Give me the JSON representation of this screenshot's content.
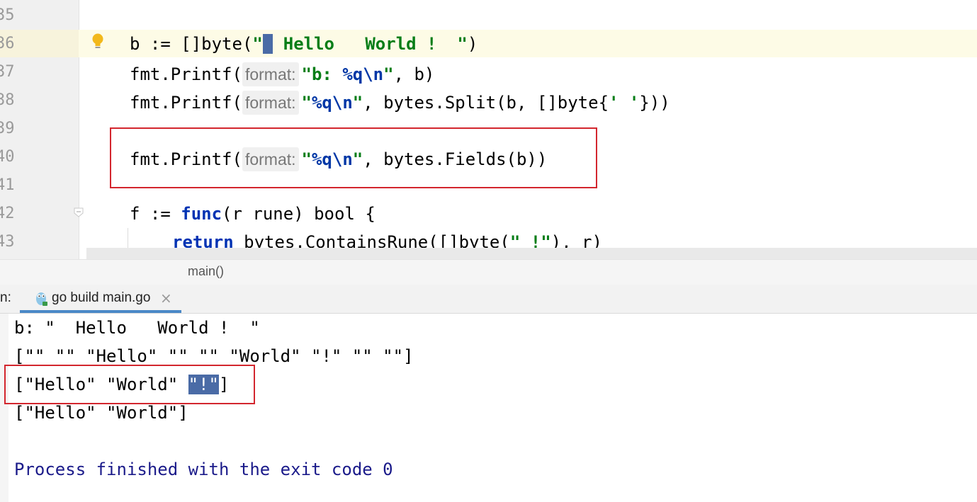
{
  "editor": {
    "line_numbers": [
      "35",
      "36",
      "37",
      "38",
      "39",
      "40",
      "41",
      "42",
      "43"
    ],
    "line36": {
      "prefix": "b := []byte(",
      "str_a": "\"",
      "str_b": " Hello   World !  \"",
      "suffix": ")"
    },
    "line37": {
      "prefix": "fmt.Printf(",
      "hint": "format:",
      "str": "\"b: ",
      "esc": "%q\\n",
      "str_end": "\"",
      "suffix": ", b)"
    },
    "line38": {
      "prefix": "fmt.Printf(",
      "hint": "format:",
      "str": "\"",
      "esc": "%q\\n",
      "str_end": "\"",
      "mid": ", bytes.Split(b, []byte{",
      "char": "' '",
      "suffix": "}))"
    },
    "line40": {
      "prefix": "fmt.Printf(",
      "hint": "format:",
      "str": "\"",
      "esc": "%q\\n",
      "str_end": "\"",
      "suffix": ", bytes.Fields(b))"
    },
    "line42": {
      "prefix": "f := ",
      "kw": "func",
      "suffix": "(r rune) bool {"
    },
    "line43": {
      "kw": "return",
      "mid": " bytes.ContainsRune([]byte(",
      "str": "\" !\"",
      "suffix": "), r)"
    }
  },
  "breadcrumb": {
    "label": "main()"
  },
  "run": {
    "label": "n:",
    "tab_label": "go build main.go",
    "tab_close": "×"
  },
  "console": {
    "line1": "b: \"  Hello   World !  \"",
    "line2": "[\"\" \"\" \"Hello\" \"\" \"\" \"World\" \"!\" \"\" \"\"]",
    "line3_prefix": "[\"Hello\" \"World\" ",
    "line3_sel": "\"!\"",
    "line3_suffix": "]",
    "line4": "[\"Hello\" \"World\"]",
    "exit": "Process finished with the exit code 0"
  }
}
